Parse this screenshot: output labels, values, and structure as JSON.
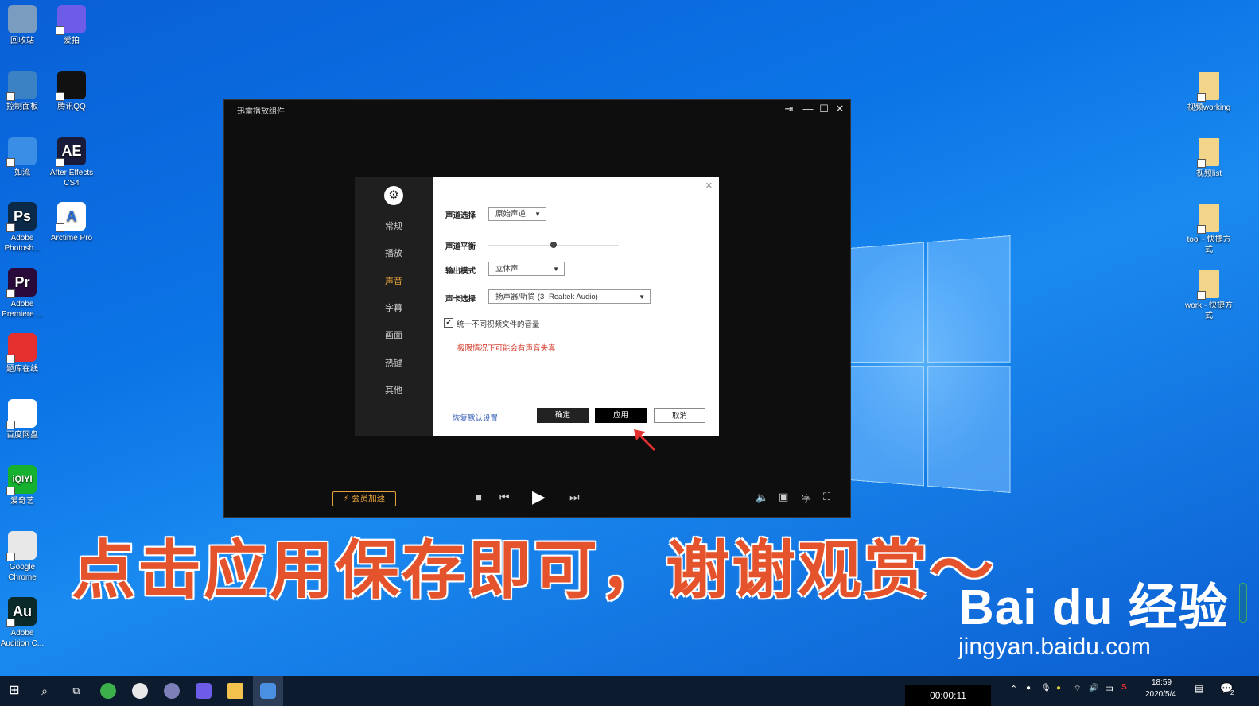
{
  "desktop": {
    "left_icons": [
      {
        "label": "回收站",
        "icon": "recycle-bin-icon",
        "color": "#7a9cbf"
      },
      {
        "label": "爱拍",
        "icon": "aipai-icon",
        "color": "#6c5ce7"
      },
      {
        "label": "控制面板",
        "icon": "control-panel-icon",
        "color": "#3b82c4"
      },
      {
        "label": "腾讯QQ",
        "icon": "qq-icon",
        "color": "#111111"
      },
      {
        "label": "如流",
        "icon": "ruliu-icon",
        "color": "#3a8ee6"
      },
      {
        "label": "After Effects CS4",
        "icon": "after-effects-icon",
        "glyph": "AE",
        "color": "#1a1a3a"
      },
      {
        "label": "Adobe Photosh...",
        "icon": "photoshop-icon",
        "glyph": "Ps",
        "color": "#0b2a4a"
      },
      {
        "label": "Arctime Pro",
        "icon": "arctime-icon",
        "glyph": "A",
        "color": "#ffffff"
      },
      {
        "label": "Adobe Premiere ...",
        "icon": "premiere-icon",
        "glyph": "Pr",
        "color": "#2a0a3a"
      },
      {
        "label": "题库在线",
        "icon": "tiku-icon",
        "color": "#e63030"
      },
      {
        "label": "百度网盘",
        "icon": "baidu-netdisk-icon",
        "color": "#ffffff"
      },
      {
        "label": "爱奇艺",
        "icon": "iqiyi-icon",
        "glyph": "iQIYI",
        "color": "#16b12f"
      },
      {
        "label": "Google Chrome",
        "icon": "chrome-icon",
        "color": "#e8e8e8"
      },
      {
        "label": "Adobe Audition C...",
        "icon": "audition-icon",
        "glyph": "Au",
        "color": "#0a2a2a"
      }
    ],
    "right_icons": [
      {
        "label": "视频working",
        "icon": "folder-shortcut-icon"
      },
      {
        "label": "视频list",
        "icon": "folder-shortcut-icon"
      },
      {
        "label": "tool - 快捷方式",
        "icon": "folder-shortcut-icon"
      },
      {
        "label": "work - 快捷方式",
        "icon": "folder-shortcut-icon"
      }
    ]
  },
  "player": {
    "title": "迅雷播放组件",
    "window_controls": {
      "pin": "⇥",
      "minimize": "—",
      "maximize": "☐",
      "close": "✕"
    },
    "vip_button": "⚡ 会员加速"
  },
  "settings": {
    "sidebar_items": [
      "常规",
      "播放",
      "声音",
      "字幕",
      "画面",
      "热键",
      "其他"
    ],
    "active_index": 2,
    "fields": {
      "channel_label": "声道选择",
      "channel_value": "原始声道",
      "balance_label": "声道平衡",
      "balance_value": 0.5,
      "output_label": "输出模式",
      "output_value": "立体声",
      "card_label": "声卡选择",
      "card_value": "扬声器/听筒 (3- Realtek Audio)"
    },
    "checkbox_label": "统一不同视频文件的音量",
    "checkbox_checked": true,
    "warning": "极限情况下可能会有声音失真",
    "reset_link": "恢复默认设置",
    "buttons": {
      "ok": "确定",
      "apply": "应用",
      "cancel": "取消"
    }
  },
  "caption": "点击应用保存即可，谢谢观赏～",
  "watermark": {
    "line1": "Bai du 经验",
    "line2": "jingyan.baidu.com"
  },
  "taskbar": {
    "timer": "00:00:11",
    "time": "18:59",
    "date": "2020/5/4",
    "ime": "中",
    "notifications": "2"
  }
}
